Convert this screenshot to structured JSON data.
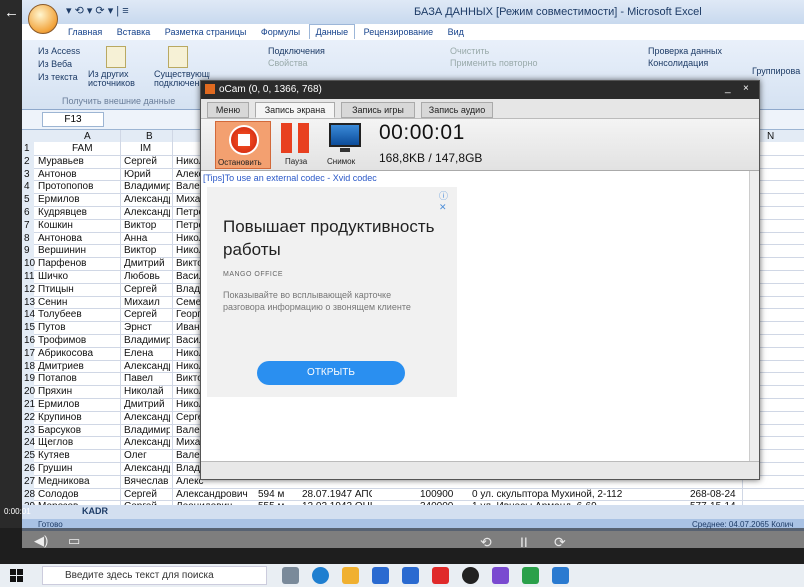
{
  "excel": {
    "quick_access": "▾ ⟲ ▾ ⟳ ▾ | ≡",
    "title": "БАЗА ДАННЫХ [Режим совместимости] - Microsoft Excel",
    "tabs": [
      "Главная",
      "Вставка",
      "Разметка страницы",
      "Формулы",
      "Данные",
      "Рецензирование",
      "Вид"
    ],
    "active_tab": "Данные",
    "ribbon": {
      "access": "Из Access",
      "web": "Из Веба",
      "text": "Из текста",
      "other": "Из других источников",
      "existing": "Существующие подключения",
      "group_label": "Получить внешние данные",
      "connections": "Подключения",
      "properties": "Свойства",
      "clear": "Очистить",
      "reapply": "Применить повторно",
      "validation": "Проверка данных",
      "consolidation": "Консолидация",
      "grouping": "Группирова"
    },
    "namebox": "F13",
    "columns": [
      "A",
      "B",
      "N"
    ],
    "header_row": {
      "num": "1",
      "a": "FAM",
      "b": "IM"
    },
    "rows": [
      {
        "n": "2",
        "a": "Муравьев",
        "b": "Сергей",
        "c": "Никол"
      },
      {
        "n": "3",
        "a": "Антонов",
        "b": "Юрий",
        "c": "Алекс"
      },
      {
        "n": "4",
        "a": "Протопопов",
        "b": "Владимир",
        "c": "Вален"
      },
      {
        "n": "5",
        "a": "Ермилов",
        "b": "Александр",
        "c": "Михай"
      },
      {
        "n": "6",
        "a": "Кудрявцев",
        "b": "Александр",
        "c": "Петро"
      },
      {
        "n": "7",
        "a": "Кошкин",
        "b": "Виктор",
        "c": "Петро"
      },
      {
        "n": "8",
        "a": "Антонова",
        "b": "Анна",
        "c": "Никол"
      },
      {
        "n": "9",
        "a": "Вершинин",
        "b": "Виктор",
        "c": "Никол"
      },
      {
        "n": "10",
        "a": "Парфенов",
        "b": "Дмитрий",
        "c": "Викто"
      },
      {
        "n": "11",
        "a": "Шичко",
        "b": "Любовь",
        "c": "Васил"
      },
      {
        "n": "12",
        "a": "Птицын",
        "b": "Сергей",
        "c": "Влади"
      },
      {
        "n": "13",
        "a": "Сенин",
        "b": "Михаил",
        "c": "Семен"
      },
      {
        "n": "14",
        "a": "Толубеев",
        "b": "Сергей",
        "c": "Георг"
      },
      {
        "n": "15",
        "a": "Путов",
        "b": "Эрнст",
        "c": "Ивано"
      },
      {
        "n": "16",
        "a": "Трофимов",
        "b": "Владимир",
        "c": "Васил"
      },
      {
        "n": "17",
        "a": "Абрикосова",
        "b": "Елена",
        "c": "Никол"
      },
      {
        "n": "18",
        "a": "Дмитриев",
        "b": "Александр",
        "c": "Никол"
      },
      {
        "n": "19",
        "a": "Потапов",
        "b": "Павел",
        "c": "Викто"
      },
      {
        "n": "20",
        "a": "Пряхин",
        "b": "Николай",
        "c": "Никол"
      },
      {
        "n": "21",
        "a": "Ермилов",
        "b": "Дмитрий",
        "c": "Никол"
      },
      {
        "n": "22",
        "a": "Крупинов",
        "b": "Александр",
        "c": "Серге"
      },
      {
        "n": "23",
        "a": "Барсуков",
        "b": "Владимир",
        "c": "Вален"
      },
      {
        "n": "24",
        "a": "Щеглов",
        "b": "Александр",
        "c": "Михай"
      },
      {
        "n": "25",
        "a": "Кутяев",
        "b": "Олег",
        "c": "Валер"
      },
      {
        "n": "26",
        "a": "Грушин",
        "b": "Александр",
        "c": "Влади"
      },
      {
        "n": "27",
        "a": "Медникова",
        "b": "Вячеслав",
        "c": "Алекс"
      }
    ],
    "wide_rows": [
      {
        "n": "28",
        "a": "Солодов",
        "b": "Сергей",
        "c": "Александрович",
        "d": "594 м",
        "e": "28.07.1947 АПС",
        "f": "100900",
        "g": "0 ул. скульптора Мухиной, 2-112",
        "h": "268-08-24"
      },
      {
        "n": "29",
        "a": "Морозов",
        "b": "Сергей",
        "c": "Леонидович",
        "d": "555 м",
        "e": "12.02.1942 ОНК",
        "f": "340000",
        "g": "1 ул. Ивнесы Арманд, 6-69",
        "h": "577-15-14"
      },
      {
        "n": "30",
        "a": "Гусев",
        "b": "Николай",
        "c": "Александрович",
        "d": "908 м",
        "e": "30.08.1967 АПС",
        "f": "230000",
        "g": "1 Севастопольский пр-т, 84-89",
        "h": "876-45-97"
      }
    ],
    "sheet_tab": "KADR",
    "status_left": "Готово",
    "status_right": "Среднее: 04.07.2065   Колич"
  },
  "ocam": {
    "title": "oCam (0, 0, 1366, 768)",
    "close": "×",
    "minimize": "_",
    "tabs": [
      "Меню",
      "Запись экрана",
      "Запись игры",
      "Запись аудио"
    ],
    "active_tab": "Запись экрана",
    "stop_label": "Остановить",
    "pause_label": "Пауза",
    "snapshot_label": "Снимок",
    "timer": "00:00:01",
    "size": "168,8KB / 147,8GB",
    "tips": "[Tips]To use an external codec - Xvid codec",
    "ad": {
      "close": "ⓘ ✕",
      "title": "Повышает продуктивность работы",
      "brand": "MANGO OFFICE",
      "description": "Показывайте во всплывающей карточке разговора информацию о звонящем клиенте",
      "button": "ОТКРЫТЬ"
    }
  },
  "player": {
    "time": "0:00:01",
    "rewind": "⟲",
    "pause": "II",
    "forward": "⟳",
    "back": "←"
  },
  "taskbar": {
    "search_placeholder": "Введите здесь текст для поиска"
  },
  "colors": {
    "stop_bg": "#f3a070",
    "record_red": "#e84020",
    "ad_button": "#2a8ff0"
  }
}
